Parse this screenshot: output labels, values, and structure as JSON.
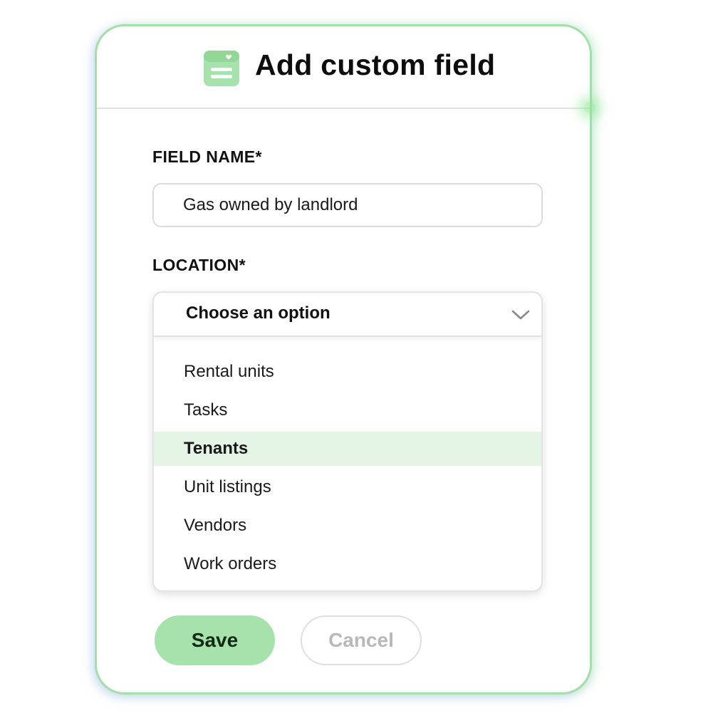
{
  "modal": {
    "title": "Add custom field",
    "header_icon": "custom-field-card-icon"
  },
  "field_name": {
    "label": "FIELD NAME*",
    "value": "Gas owned by landlord"
  },
  "location": {
    "label": "LOCATION*",
    "selected_display": "Choose an option",
    "chevron_icon": "chevron-down-icon",
    "options": [
      {
        "label": "Rental units",
        "highlighted": false
      },
      {
        "label": "Tasks",
        "highlighted": false
      },
      {
        "label": "Tenants",
        "highlighted": true
      },
      {
        "label": "Unit listings",
        "highlighted": false
      },
      {
        "label": "Vendors",
        "highlighted": false
      },
      {
        "label": "Work orders",
        "highlighted": false
      }
    ]
  },
  "actions": {
    "save_label": "Save",
    "cancel_label": "Cancel"
  },
  "colors": {
    "accent_green": "#a7e2ac",
    "highlight_row": "#e5f5e5",
    "border_green": "#a6dda9"
  }
}
